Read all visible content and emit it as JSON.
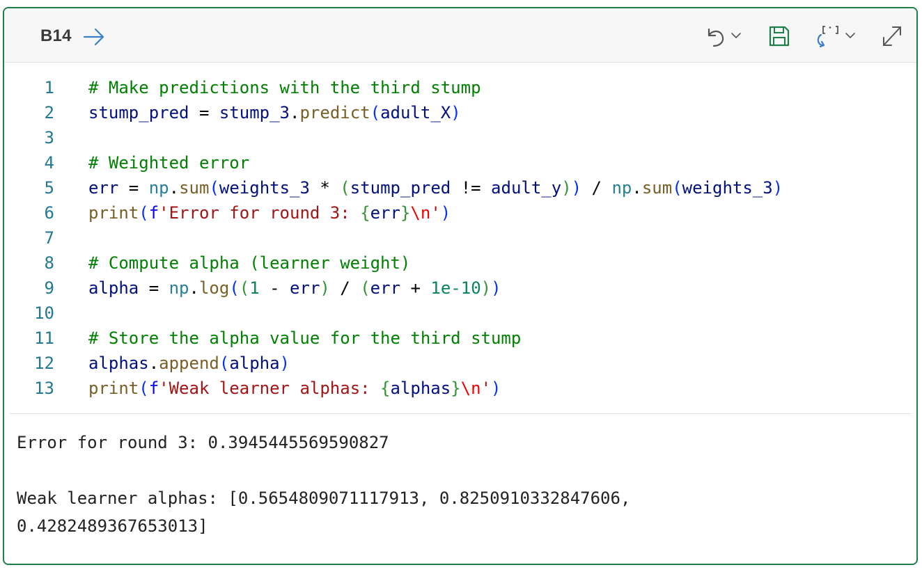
{
  "header": {
    "cell_id": "B14",
    "icons": {
      "nav": "arrow-right-icon",
      "undo": "undo-icon",
      "undo_menu": "chevron-down-icon",
      "save": "save-icon",
      "refresh": "refresh-icon",
      "refresh_menu": "chevron-down-icon",
      "expand": "expand-icon"
    }
  },
  "colors": {
    "cell_border": "#1e7e4a",
    "line_number": "#237893",
    "comment": "#008000",
    "variable": "#001080",
    "function": "#795e26",
    "string": "#a31515",
    "number": "#098658",
    "toolbar_icon": "#555555",
    "save_icon": "#1e7e4a",
    "nav_arrow": "#3b7fc4"
  },
  "code": {
    "lines": [
      {
        "num": "1",
        "tokens": [
          {
            "t": "# Make predictions with the third stump",
            "c": "comment"
          }
        ]
      },
      {
        "num": "2",
        "tokens": [
          {
            "t": "stump_pred",
            "c": "var"
          },
          {
            "t": " = ",
            "c": "op"
          },
          {
            "t": "stump_3",
            "c": "var"
          },
          {
            "t": ".",
            "c": "op"
          },
          {
            "t": "predict",
            "c": "fn"
          },
          {
            "t": "(",
            "c": "paren"
          },
          {
            "t": "adult_X",
            "c": "var"
          },
          {
            "t": ")",
            "c": "paren"
          }
        ]
      },
      {
        "num": "3",
        "tokens": []
      },
      {
        "num": "4",
        "tokens": [
          {
            "t": "# Weighted error",
            "c": "comment"
          }
        ]
      },
      {
        "num": "5",
        "tokens": [
          {
            "t": "err",
            "c": "var"
          },
          {
            "t": " = ",
            "c": "op"
          },
          {
            "t": "np",
            "c": "mod"
          },
          {
            "t": ".",
            "c": "op"
          },
          {
            "t": "sum",
            "c": "fn"
          },
          {
            "t": "(",
            "c": "paren"
          },
          {
            "t": "weights_3",
            "c": "var"
          },
          {
            "t": " * ",
            "c": "op"
          },
          {
            "t": "(",
            "c": "paren2"
          },
          {
            "t": "stump_pred",
            "c": "var"
          },
          {
            "t": " != ",
            "c": "op"
          },
          {
            "t": "adult_y",
            "c": "var"
          },
          {
            "t": ")",
            "c": "paren2"
          },
          {
            "t": ")",
            "c": "paren"
          },
          {
            "t": " / ",
            "c": "op"
          },
          {
            "t": "np",
            "c": "mod"
          },
          {
            "t": ".",
            "c": "op"
          },
          {
            "t": "sum",
            "c": "fn"
          },
          {
            "t": "(",
            "c": "paren"
          },
          {
            "t": "weights_3",
            "c": "var"
          },
          {
            "t": ")",
            "c": "paren"
          }
        ]
      },
      {
        "num": "6",
        "tokens": [
          {
            "t": "print",
            "c": "fn"
          },
          {
            "t": "(",
            "c": "paren"
          },
          {
            "t": "f",
            "c": "kw"
          },
          {
            "t": "'Error for round 3: ",
            "c": "str"
          },
          {
            "t": "{",
            "c": "brace"
          },
          {
            "t": "err",
            "c": "var"
          },
          {
            "t": "}",
            "c": "brace"
          },
          {
            "t": "\\n",
            "c": "esc"
          },
          {
            "t": "'",
            "c": "str"
          },
          {
            "t": ")",
            "c": "paren"
          }
        ]
      },
      {
        "num": "7",
        "tokens": []
      },
      {
        "num": "8",
        "tokens": [
          {
            "t": "# Compute alpha (learner weight)",
            "c": "comment"
          }
        ]
      },
      {
        "num": "9",
        "tokens": [
          {
            "t": "alpha",
            "c": "var"
          },
          {
            "t": " = ",
            "c": "op"
          },
          {
            "t": "np",
            "c": "mod"
          },
          {
            "t": ".",
            "c": "op"
          },
          {
            "t": "log",
            "c": "fn"
          },
          {
            "t": "(",
            "c": "paren"
          },
          {
            "t": "(",
            "c": "paren2"
          },
          {
            "t": "1",
            "c": "num"
          },
          {
            "t": " - ",
            "c": "op"
          },
          {
            "t": "err",
            "c": "var"
          },
          {
            "t": ")",
            "c": "paren2"
          },
          {
            "t": " / ",
            "c": "op"
          },
          {
            "t": "(",
            "c": "paren2"
          },
          {
            "t": "err",
            "c": "var"
          },
          {
            "t": " + ",
            "c": "op"
          },
          {
            "t": "1e-10",
            "c": "num"
          },
          {
            "t": ")",
            "c": "paren2"
          },
          {
            "t": ")",
            "c": "paren"
          }
        ]
      },
      {
        "num": "10",
        "tokens": []
      },
      {
        "num": "11",
        "tokens": [
          {
            "t": "# Store the alpha value for the third stump",
            "c": "comment"
          }
        ]
      },
      {
        "num": "12",
        "tokens": [
          {
            "t": "alphas",
            "c": "var"
          },
          {
            "t": ".",
            "c": "op"
          },
          {
            "t": "append",
            "c": "fn"
          },
          {
            "t": "(",
            "c": "paren"
          },
          {
            "t": "alpha",
            "c": "var"
          },
          {
            "t": ")",
            "c": "paren"
          }
        ]
      },
      {
        "num": "13",
        "tokens": [
          {
            "t": "print",
            "c": "fn"
          },
          {
            "t": "(",
            "c": "paren"
          },
          {
            "t": "f",
            "c": "kw"
          },
          {
            "t": "'Weak learner alphas: ",
            "c": "str"
          },
          {
            "t": "{",
            "c": "brace"
          },
          {
            "t": "alphas",
            "c": "var"
          },
          {
            "t": "}",
            "c": "brace"
          },
          {
            "t": "\\n",
            "c": "esc"
          },
          {
            "t": "'",
            "c": "str"
          },
          {
            "t": ")",
            "c": "paren"
          }
        ]
      }
    ]
  },
  "output": {
    "line1": "Error for round 3: 0.3945445569590827",
    "line2": "Weak learner alphas: [0.5654809071117913, 0.8250910332847606,",
    "line3": "0.4282489367653013]"
  }
}
